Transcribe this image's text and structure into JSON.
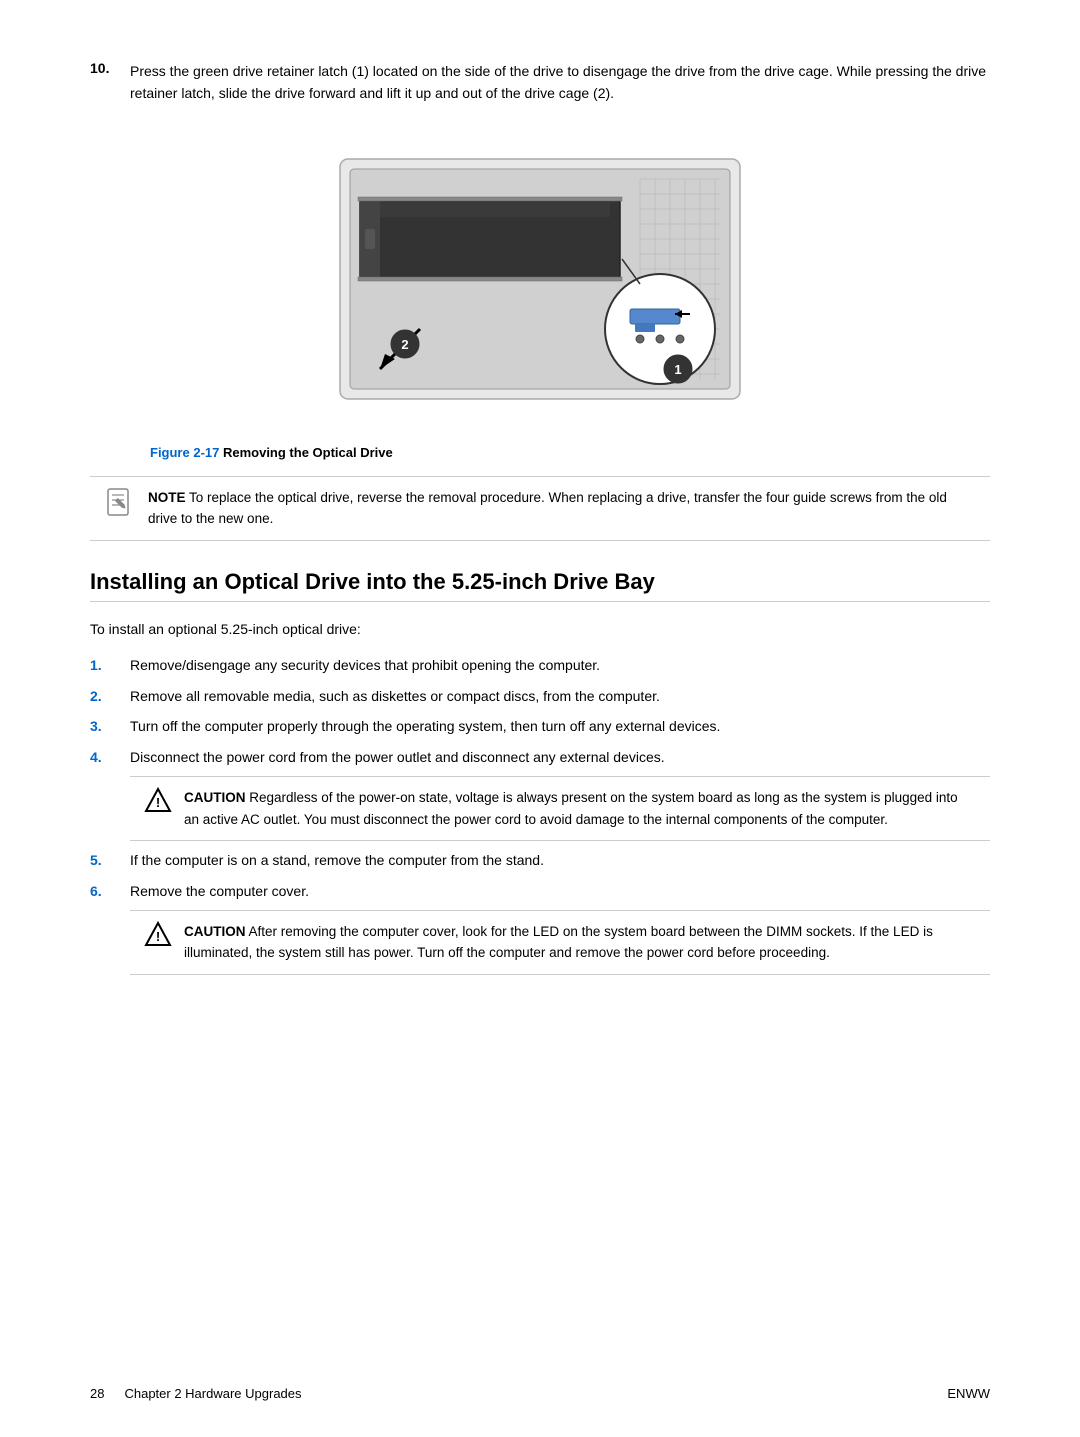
{
  "page": {
    "step10": {
      "number": "10.",
      "text": "Press the green drive retainer latch (1) located on the side of the drive to disengage the drive from the drive cage. While pressing the drive retainer latch, slide the drive forward and lift it up and out of the drive cage (2)."
    },
    "figure": {
      "caption_bold": "Figure 2-17",
      "caption_text": "  Removing the Optical Drive"
    },
    "note": {
      "label": "NOTE",
      "text": "  To replace the optical drive, reverse the removal procedure. When replacing a drive, transfer the four guide screws from the old drive to the new one."
    },
    "section_title": "Installing an Optical Drive into the 5.25-inch Drive Bay",
    "section_intro": "To install an optional 5.25-inch optical drive:",
    "steps": [
      {
        "num": "1.",
        "text": "Remove/disengage any security devices that prohibit opening the computer."
      },
      {
        "num": "2.",
        "text": "Remove all removable media, such as diskettes or compact discs, from the computer."
      },
      {
        "num": "3.",
        "text": "Turn off the computer properly through the operating system, then turn off any external devices."
      },
      {
        "num": "4.",
        "text": "Disconnect the power cord from the power outlet and disconnect any external devices."
      }
    ],
    "caution1": {
      "label": "CAUTION",
      "text": "  Regardless of the power-on state, voltage is always present on the system board as long as the system is plugged into an active AC outlet. You must disconnect the power cord to avoid damage to the internal components of the computer."
    },
    "steps2": [
      {
        "num": "5.",
        "text": "If the computer is on a stand, remove the computer from the stand."
      },
      {
        "num": "6.",
        "text": "Remove the computer cover."
      }
    ],
    "caution2": {
      "label": "CAUTION",
      "text": "  After removing the computer cover, look for the LED on the system board between the DIMM sockets. If the LED is illuminated, the system still has power. Turn off the computer and remove the power cord before proceeding."
    },
    "footer": {
      "page_num": "28",
      "chapter": "Chapter 2   Hardware Upgrades",
      "right": "ENWW"
    }
  }
}
